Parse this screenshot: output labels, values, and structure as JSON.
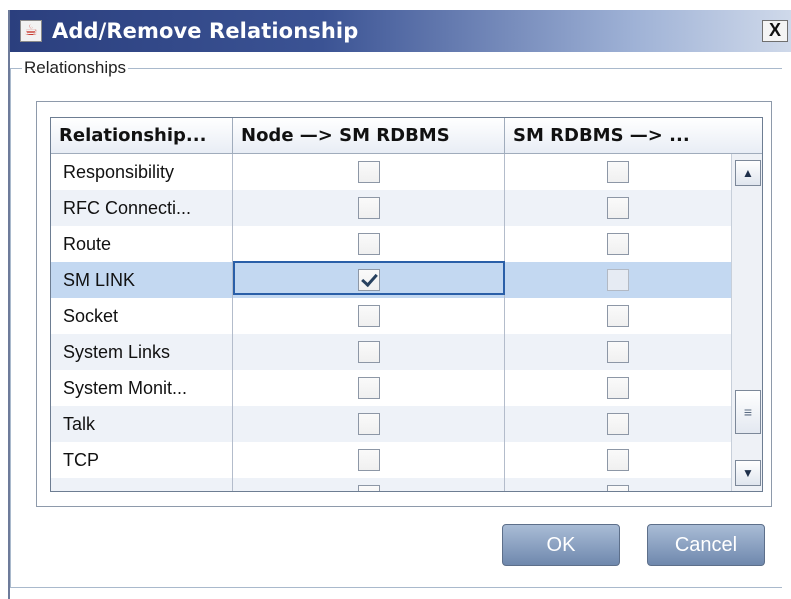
{
  "window": {
    "title": "Add/Remove Relationship",
    "close_label": "X"
  },
  "group": {
    "label": "Relationships"
  },
  "table": {
    "columns": [
      "Relationship...",
      "Node —> SM RDBMS",
      "SM RDBMS —> ..."
    ],
    "rows": [
      {
        "name": "Responsibility",
        "node_to_sm": false,
        "sm_to": false,
        "selected": false,
        "stripe": false
      },
      {
        "name": "RFC Connecti...",
        "node_to_sm": false,
        "sm_to": false,
        "selected": false,
        "stripe": true
      },
      {
        "name": "Route",
        "node_to_sm": false,
        "sm_to": false,
        "selected": false,
        "stripe": false
      },
      {
        "name": "SM LINK",
        "node_to_sm": true,
        "sm_to": false,
        "selected": true,
        "stripe": false
      },
      {
        "name": "Socket",
        "node_to_sm": false,
        "sm_to": false,
        "selected": false,
        "stripe": false
      },
      {
        "name": "System Links",
        "node_to_sm": false,
        "sm_to": false,
        "selected": false,
        "stripe": true
      },
      {
        "name": "System Monit...",
        "node_to_sm": false,
        "sm_to": false,
        "selected": false,
        "stripe": false
      },
      {
        "name": "Talk",
        "node_to_sm": false,
        "sm_to": false,
        "selected": false,
        "stripe": true
      },
      {
        "name": "TCP",
        "node_to_sm": false,
        "sm_to": false,
        "selected": false,
        "stripe": false
      },
      {
        "name": "",
        "node_to_sm": false,
        "sm_to": false,
        "selected": false,
        "stripe": true
      }
    ]
  },
  "scrollbar": {
    "up_glyph": "▲",
    "down_glyph": "▼",
    "thumb_glyph": "≡",
    "position": 0.78
  },
  "buttons": {
    "ok_label": "OK",
    "cancel_label": "Cancel"
  },
  "colors": {
    "selected_row": "#c3d8f1",
    "stripe_row": "#eef2f8",
    "title_bar": "#2b3f7e"
  },
  "icons": {
    "app": "java-app-icon",
    "close": "close-icon",
    "check": "checkmark-icon"
  }
}
